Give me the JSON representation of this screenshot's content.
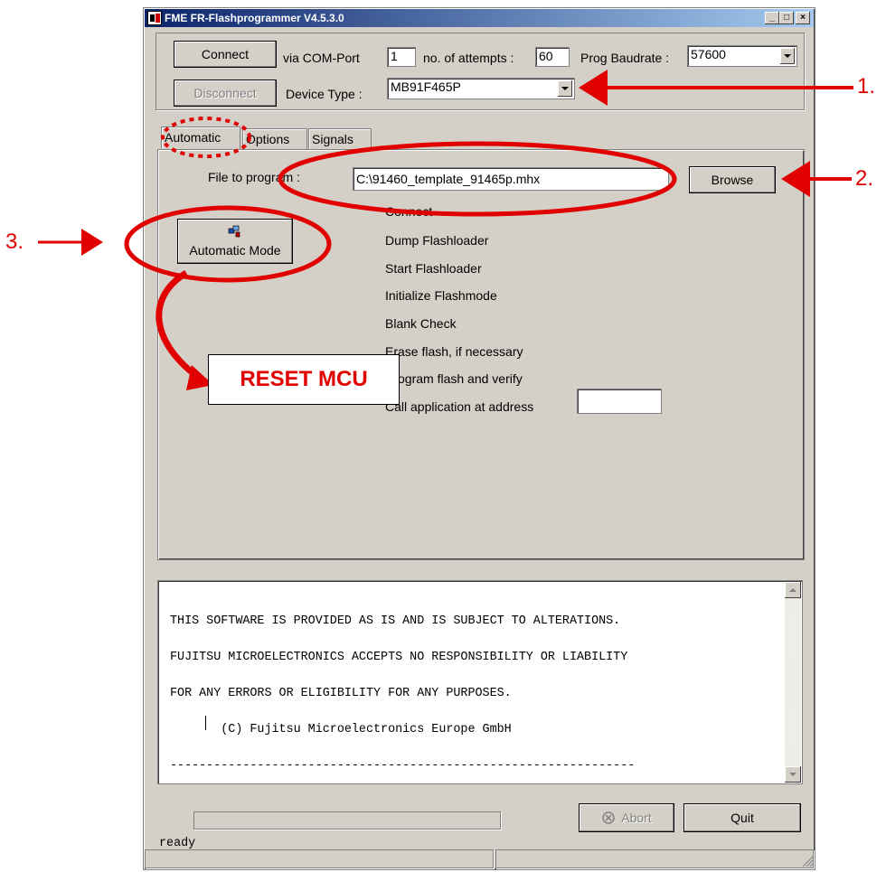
{
  "window": {
    "title": "FME FR-Flashprogrammer V4.5.3.0",
    "controls": [
      "minimize",
      "maximize",
      "close"
    ]
  },
  "connection": {
    "connect_label": "Connect",
    "disconnect_label": "Disconnect",
    "com_port_label": "via COM-Port",
    "com_port_value": "1",
    "attempts_label": "no. of attempts :",
    "attempts_value": "60",
    "baudrate_label": "Prog Baudrate :",
    "baudrate_value": "57600",
    "device_type_label": "Device Type :",
    "device_type_value": "MB91F465P"
  },
  "tabs": [
    {
      "label": "Automatic",
      "active": true
    },
    {
      "label": "Options",
      "active": false
    },
    {
      "label": "Signals",
      "active": false
    }
  ],
  "automatic": {
    "file_label": "File to program :",
    "file_value": "C:\\91460_template_91465p.mhx",
    "browse_label": "Browse",
    "auto_mode_label": "Automatic Mode",
    "steps": [
      "Connect",
      "Dump Flashloader",
      "Start Flashloader",
      "Initialize Flashmode",
      "Blank Check",
      "Erase flash, if necessary",
      "Program flash and verify",
      "Call application at address"
    ],
    "call_address_value": ""
  },
  "log": {
    "lines": [
      "THIS SOFTWARE IS PROVIDED AS IS AND IS SUBJECT TO ALTERATIONS.",
      "FUJITSU MICROELECTRONICS ACCEPTS NO RESPONSIBILITY OR LIABILITY",
      "FOR ANY ERRORS OR ELIGIBILITY FOR ANY PURPOSES.",
      "       (C) Fujitsu Microelectronics Europe GmbH",
      "----------------------------------------------------------------",
      "",
      "ready"
    ]
  },
  "footer": {
    "abort_label": "Abort",
    "quit_label": "Quit",
    "progress": 0
  },
  "annotations": {
    "marker_1": "1.",
    "marker_2": "2.",
    "marker_3": "3.",
    "reset_label": "RESET MCU",
    "color": "#e00000"
  },
  "icons": [
    "app-icon",
    "automatic-mode-icon",
    "abort-icon",
    "combo-arrow-icon",
    "scroll-up-icon",
    "scroll-down-icon",
    "resize-grip-icon"
  ]
}
